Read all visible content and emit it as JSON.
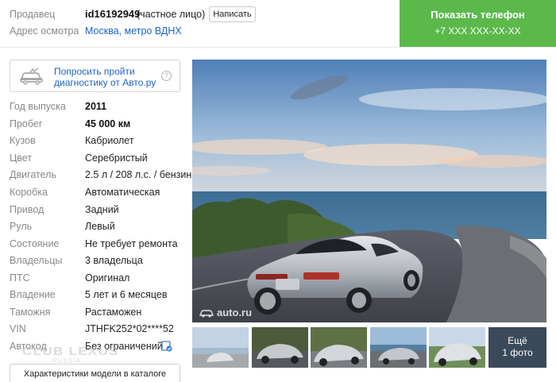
{
  "seller": {
    "label": "Продавец",
    "id": "id16192949",
    "type": "(частное лицо)",
    "write_button": "Написать"
  },
  "address": {
    "label": "Адрес осмотра",
    "value": "Москва, метро ВДНХ"
  },
  "phone": {
    "title": "Показать телефон",
    "number": "+7 XXX XXX-XX-XX"
  },
  "diagnostics": {
    "text": "Попросить пройти диагностику от Авто.ру",
    "help": "?"
  },
  "specs": [
    {
      "label": "Год выпуска",
      "value": "2011",
      "bold": true
    },
    {
      "label": "Пробег",
      "value": "45 000 км",
      "bold": true
    },
    {
      "label": "Кузов",
      "value": "Кабриолет"
    },
    {
      "label": "Цвет",
      "value": "Серебристый"
    },
    {
      "label": "Двигатель",
      "value": "2.5 л / 208 л.с. / бензин"
    },
    {
      "label": "Коробка",
      "value": "Автоматическая"
    },
    {
      "label": "Привод",
      "value": "Задний"
    },
    {
      "label": "Руль",
      "value": "Левый"
    },
    {
      "label": "Состояние",
      "value": "Не требует ремонта"
    },
    {
      "label": "Владельцы",
      "value": "3 владельца"
    },
    {
      "label": "ПТС",
      "value": "Оригинал"
    },
    {
      "label": "Владение",
      "value": "5 лет и 6 месяцев"
    },
    {
      "label": "Таможня",
      "value": "Растаможен"
    },
    {
      "label": "VIN",
      "value": "JTHFK252*02****52"
    },
    {
      "label": "Автокод",
      "value": "Без ограничений"
    }
  ],
  "catalog_button": "Характеристики модели в каталоге",
  "watermark": {
    "main": "CLUB LEXUS",
    "sub": "RUSSIA"
  },
  "photo": {
    "watermark": "auto.ru"
  },
  "more_photos": {
    "line1": "Ещё",
    "line2": "1 фото"
  },
  "colors": {
    "phone_green": "#5bb94a",
    "link_blue": "#1a64c8"
  }
}
